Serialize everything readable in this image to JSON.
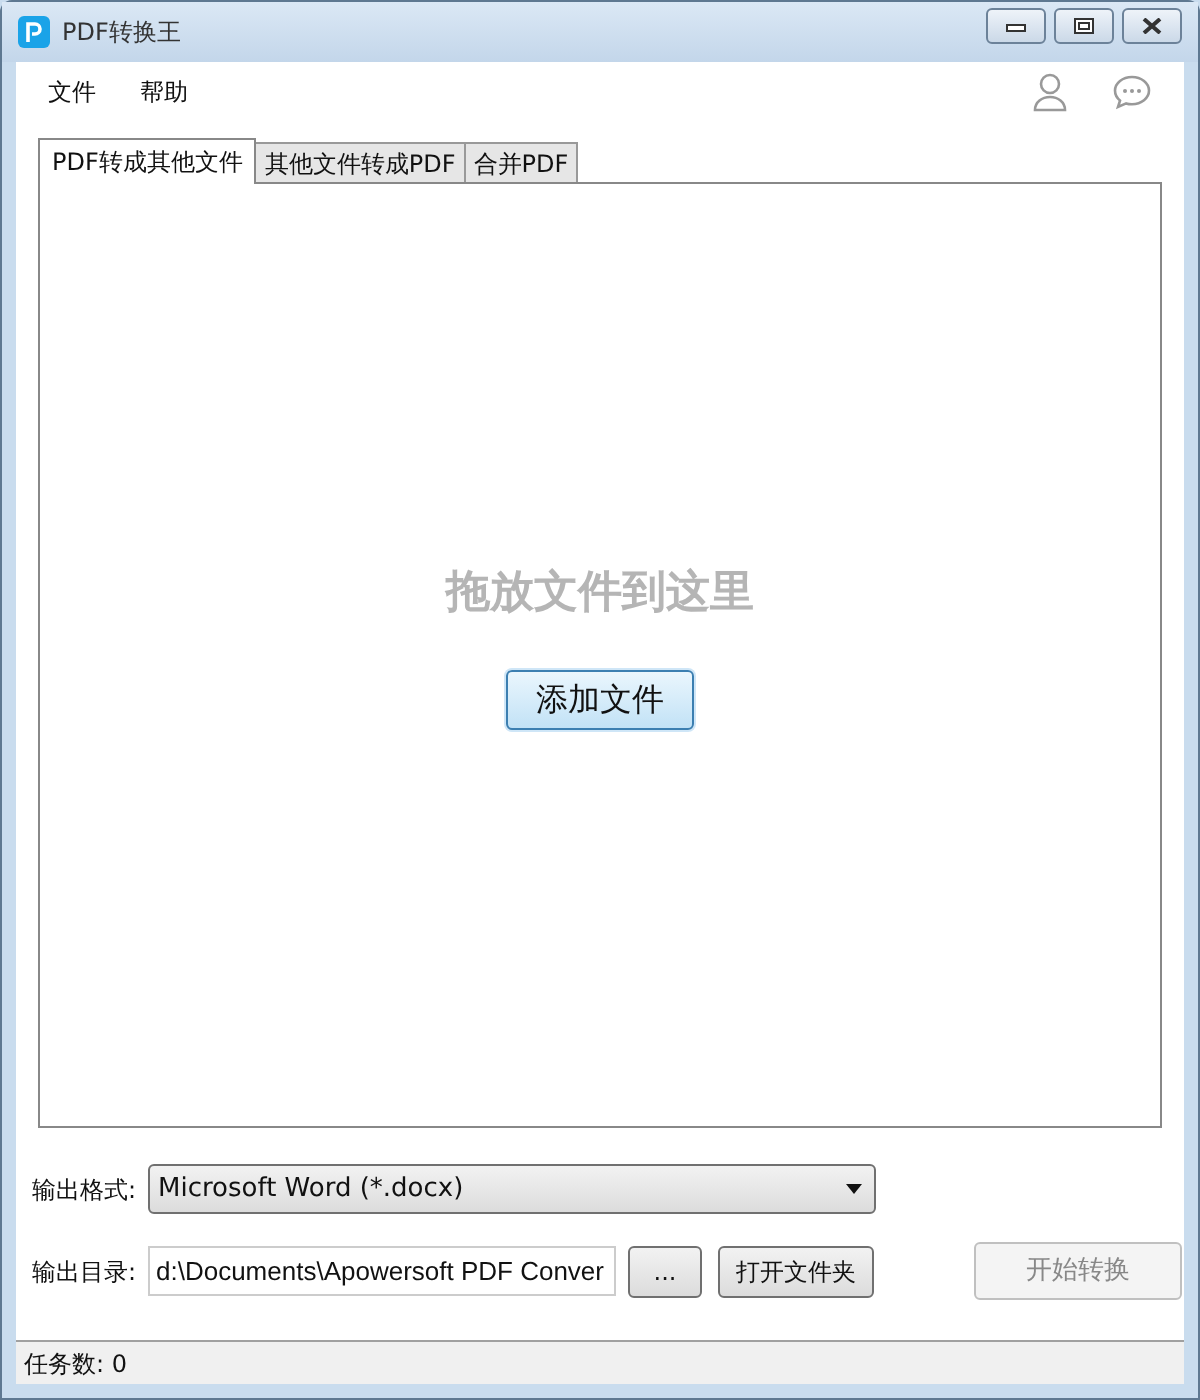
{
  "window": {
    "title": "PDF转换王"
  },
  "menu": [
    "文件",
    "帮助"
  ],
  "tabs": [
    {
      "label": "PDF转成其他文件",
      "selected": true
    },
    {
      "label": "其他文件转成PDF",
      "selected": false
    },
    {
      "label": "合并PDF",
      "selected": false
    }
  ],
  "drop_zone": {
    "hint": "拖放文件到这里",
    "button": "添加文件"
  },
  "output_format": {
    "label": "输出格式:",
    "value": "Microsoft Word (*.docx)"
  },
  "output_dir": {
    "label": "输出目录:",
    "value": "d:\\Documents\\Apowersoft PDF Conver",
    "browse": "...",
    "open_folder": "打开文件夹"
  },
  "start_button": {
    "label": "开始转换",
    "disabled": true
  },
  "status_bar": {
    "text": "任务数: 0"
  }
}
